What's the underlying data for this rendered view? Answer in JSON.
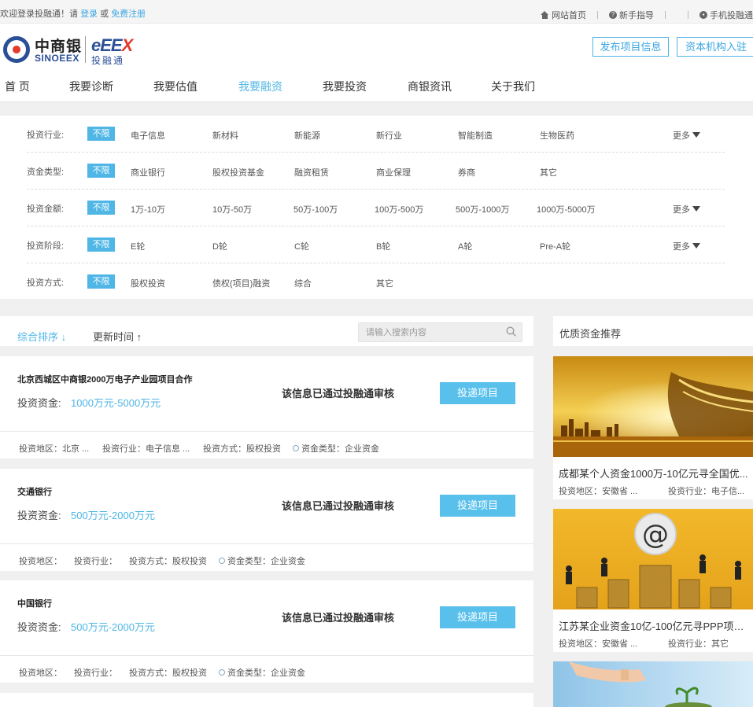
{
  "topbar": {
    "welcome": "欢迎登录投融通！请",
    "login": "登录",
    "or": "或",
    "register": "免费注册",
    "home": "网站首页",
    "guide": "新手指导",
    "mobile": "手机投融通"
  },
  "logo": {
    "cn": "中商银",
    "en": "SINOEEX",
    "ex_a": "eEE",
    "ex_b": "X",
    "sub": "投融通"
  },
  "header": {
    "publish": "发布项目信息",
    "join": "资本机构入驻"
  },
  "nav": [
    "首 页",
    "我要诊断",
    "我要估值",
    "我要融资",
    "我要投资",
    "商银资讯",
    "关于我们"
  ],
  "filters": {
    "unlimited": "不限",
    "more": "更多",
    "rows": [
      {
        "label": "投资行业:",
        "options": [
          "电子信息",
          "新材料",
          "新能源",
          "新行业",
          "智能制造",
          "生物医药"
        ]
      },
      {
        "label": "资金类型:",
        "options": [
          "商业银行",
          "股权投资基金",
          "融资租赁",
          "商业保理",
          "券商",
          "其它"
        ]
      },
      {
        "label": "投资金额:",
        "options": [
          "1万-10万",
          "10万-50万",
          "50万-100万",
          "100万-500万",
          "500万-1000万",
          "1000万-5000万"
        ]
      },
      {
        "label": "投资阶段:",
        "options": [
          "E轮",
          "D轮",
          "C轮",
          "B轮",
          "A轮",
          "Pre-A轮"
        ]
      },
      {
        "label": "投资方式:",
        "options": [
          "股权投资",
          "债权(项目)融资",
          "综合",
          "其它"
        ]
      }
    ]
  },
  "sort": {
    "comprehensive": "综合排序 ↓",
    "update_time": "更新时间 ↑",
    "search_placeholder": "请输入搜索内容"
  },
  "projects": [
    {
      "title": "北京西城区中商银2000万电子产业园项目合作",
      "amount_label": "投资资金:",
      "amount": "1000万元-5000万元",
      "verified": "该信息已通过投融通审核",
      "button": "投递项目",
      "region": "投资地区：北京 ...",
      "industry": "投资行业：电子信息 ...",
      "method": "投资方式：股权投资",
      "fund_type": "资金类型：企业资金"
    },
    {
      "title": "交通银行",
      "amount_label": "投资资金:",
      "amount": "500万元-2000万元",
      "verified": "该信息已通过投融通审核",
      "button": "投递项目",
      "region": "投资地区：",
      "industry": "投资行业：",
      "method": "投资方式：股权投资",
      "fund_type": "资金类型：企业资金"
    },
    {
      "title": "中国银行",
      "amount_label": "投资资金:",
      "amount": "500万元-2000万元",
      "verified": "该信息已通过投融通审核",
      "button": "投递项目",
      "region": "投资地区：",
      "industry": "投资行业：",
      "method": "投资方式：股权投资",
      "fund_type": "资金类型：企业资金"
    }
  ],
  "recommend": {
    "heading": "优质资金推荐",
    "items": [
      {
        "title": "成都某个人资金1000万-10亿元寻全国优...",
        "region": "投资地区：安徽省 ...",
        "industry": "投资行业：电子信..."
      },
      {
        "title": "江苏某企业资金10亿-100亿元寻PPP项目...",
        "region": "投资地区：安徽省 ...",
        "industry": "投资行业：其它"
      }
    ]
  },
  "colors": {
    "accent": "#4fb6e6",
    "button": "#59c0ec",
    "brand_blue": "#2b4f97",
    "brand_red": "#e23a2d"
  }
}
